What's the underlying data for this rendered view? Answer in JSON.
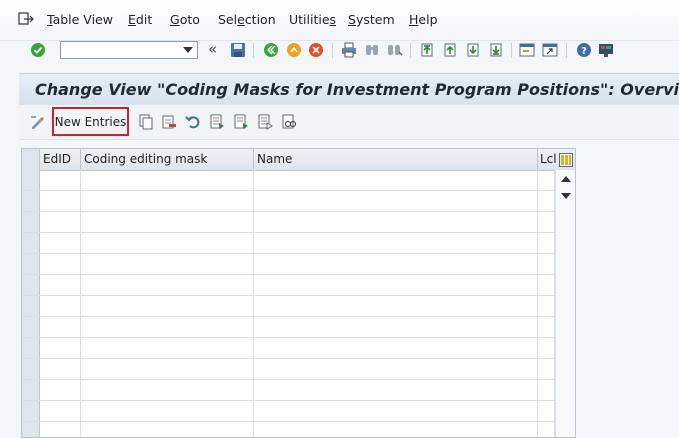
{
  "menu": {
    "items": [
      {
        "pre": "",
        "u": "T",
        "post": "able View"
      },
      {
        "pre": "",
        "u": "E",
        "post": "dit"
      },
      {
        "pre": "",
        "u": "G",
        "post": "oto"
      },
      {
        "pre": "Sel",
        "u": "e",
        "post": "ction"
      },
      {
        "pre": "Utilitie",
        "u": "s",
        "post": ""
      },
      {
        "pre": "",
        "u": "S",
        "post": "ystem"
      },
      {
        "pre": "",
        "u": "H",
        "post": "elp"
      }
    ]
  },
  "toolbar": {
    "command_value": "",
    "back_label": "«"
  },
  "title": "Change View \"Coding Masks for Investment Program Positions\": Overview",
  "app_toolbar": {
    "new_entries_label": "New Entries"
  },
  "table": {
    "columns": [
      "EdID",
      "Coding editing mask",
      "Name",
      "Lcl"
    ],
    "rows": [
      [
        "",
        "",
        "",
        ""
      ],
      [
        "",
        "",
        "",
        ""
      ],
      [
        "",
        "",
        "",
        ""
      ],
      [
        "",
        "",
        "",
        ""
      ],
      [
        "",
        "",
        "",
        ""
      ],
      [
        "",
        "",
        "",
        ""
      ],
      [
        "",
        "",
        "",
        ""
      ],
      [
        "",
        "",
        "",
        ""
      ],
      [
        "",
        "",
        "",
        ""
      ],
      [
        "",
        "",
        "",
        ""
      ],
      [
        "",
        "",
        "",
        ""
      ],
      [
        "",
        "",
        "",
        ""
      ],
      [
        "",
        "",
        "",
        ""
      ]
    ]
  },
  "colors": {
    "highlight_border": "#d4202b",
    "title_bg": "#dbe5ef",
    "ok_green": "#3aa33a"
  }
}
